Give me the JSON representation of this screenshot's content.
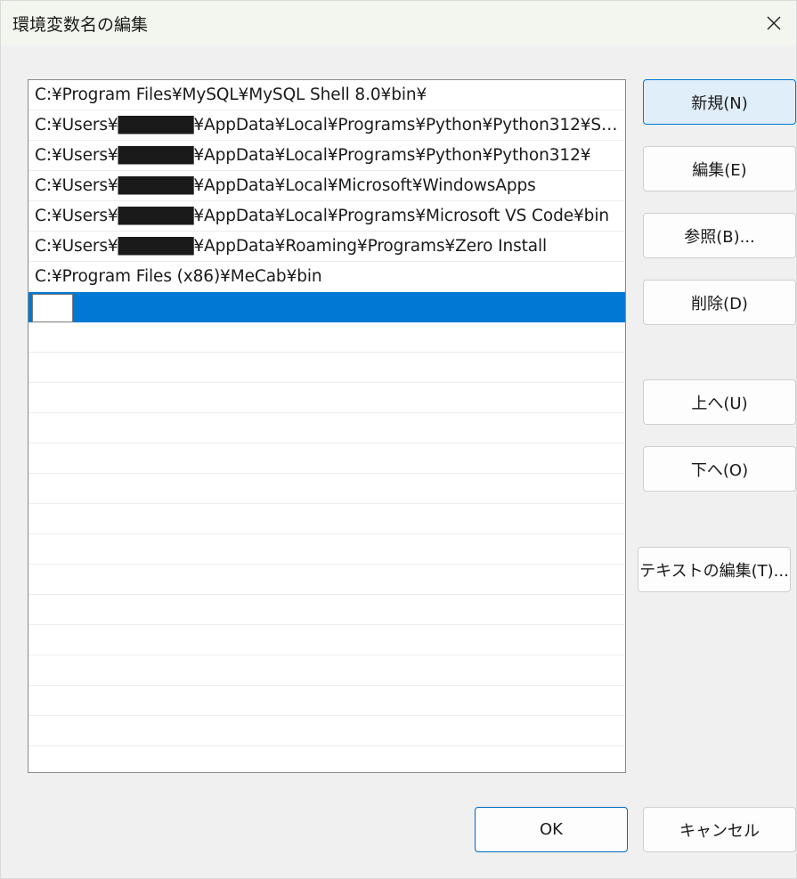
{
  "window": {
    "title": "環境変数名の編集",
    "close_glyph": "✕"
  },
  "list": {
    "rows": [
      {
        "text": "C:¥Program Files¥MySQL¥MySQL Shell 8.0¥bin¥"
      },
      {
        "text": "C:¥Users¥██████¥AppData¥Local¥Programs¥Python¥Python312¥Script…"
      },
      {
        "text": "C:¥Users¥██████¥AppData¥Local¥Programs¥Python¥Python312¥"
      },
      {
        "text": "C:¥Users¥██████¥AppData¥Local¥Microsoft¥WindowsApps"
      },
      {
        "text": "C:¥Users¥██████¥AppData¥Local¥Programs¥Microsoft VS Code¥bin"
      },
      {
        "text": "C:¥Users¥██████¥AppData¥Roaming¥Programs¥Zero Install"
      },
      {
        "text": "C:¥Program Files (x86)¥MeCab¥bin"
      }
    ],
    "editing_value": ""
  },
  "buttons": {
    "new": "新規(N)",
    "edit": "編集(E)",
    "browse": "参照(B)...",
    "delete": "削除(D)",
    "move_up": "上へ(U)",
    "move_down": "下へ(O)",
    "edit_text": "テキストの編集(T)...",
    "ok": "OK",
    "cancel": "キャンセル"
  },
  "colors": {
    "selection": "#0078d4",
    "primary_button_bg": "#e0eef9",
    "primary_button_border": "#0078d4"
  }
}
